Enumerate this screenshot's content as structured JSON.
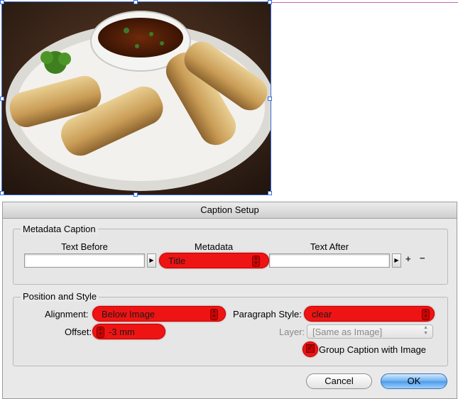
{
  "dialog": {
    "title": "Caption Setup",
    "metadata_group": {
      "label": "Metadata Caption",
      "text_before_header": "Text Before",
      "metadata_header": "Metadata",
      "text_after_header": "Text After",
      "text_before_value": "",
      "metadata_value": "Title",
      "text_after_value": ""
    },
    "position_group": {
      "label": "Position and Style",
      "alignment_label": "Alignment:",
      "alignment_value": "Below Image",
      "paragraph_style_label": "Paragraph Style:",
      "paragraph_style_value": "clear",
      "offset_label": "Offset:",
      "offset_value": "-3 mm",
      "layer_label": "Layer:",
      "layer_value": "[Same as Image]",
      "group_caption_label": "Group Caption with Image",
      "group_caption_checked": true
    },
    "buttons": {
      "cancel": "Cancel",
      "ok": "OK"
    }
  },
  "colors": {
    "highlight": "#ef1414",
    "ok_button": "#4a9bea",
    "selection": "#3b6bd6"
  },
  "icons": {
    "add": "plus-icon",
    "remove": "minus-icon",
    "insert": "triangle-right-icon"
  }
}
